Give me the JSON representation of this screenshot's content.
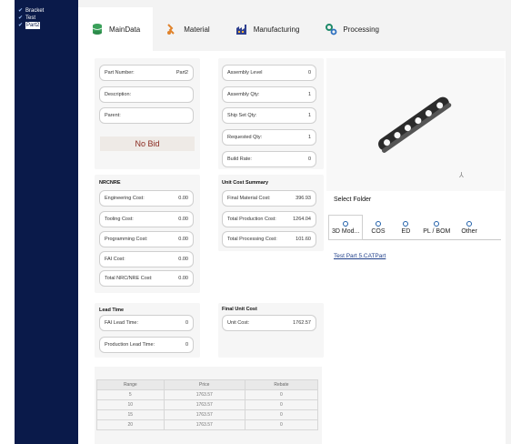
{
  "tree": [
    {
      "label": "Bracket",
      "selected": false
    },
    {
      "label": "Test",
      "selected": false
    },
    {
      "label": "Part2",
      "selected": true
    }
  ],
  "tabs": [
    {
      "label": "MainData",
      "icon": "database-icon",
      "color": "#3aa05a"
    },
    {
      "label": "Material",
      "icon": "material-icon",
      "color": "#e0822a"
    },
    {
      "label": "Manufacturing",
      "icon": "factory-icon",
      "color": "#2e3f8f"
    },
    {
      "label": "Processing",
      "icon": "gears-icon",
      "color": "#1f8a6a"
    }
  ],
  "part": {
    "number_label": "Part Number:",
    "number_value": "Part2",
    "description_label": "Description:",
    "description_value": "",
    "parent_label": "Parent:",
    "parent_value": ""
  },
  "status": "No Bid",
  "assembly": {
    "level_label": "Assembly Level",
    "level_value": "0",
    "qty_label": "Assembly Qty:",
    "qty_value": "1",
    "shipset_label": "Ship Set Qty:",
    "shipset_value": "1",
    "requested_label": "Requested Qty:",
    "requested_value": "1",
    "build_label": "Build Rate:",
    "build_value": "0"
  },
  "nrcnre": {
    "title": "NRCNRE",
    "engineering_label": "Engineering Cost:",
    "engineering_value": "0.00",
    "tooling_label": "Tooling Cost:",
    "tooling_value": "0.00",
    "programming_label": "Programming Cost:",
    "programming_value": "0.00",
    "fai_label": "FAI Cost:",
    "fai_value": "0.00",
    "total_label": "Total NRC/NRE Cost:",
    "total_value": "0.00"
  },
  "unit_summary": {
    "title": "Unit Cost Summary",
    "material_label": "Final Material Cost:",
    "material_value": "396.93",
    "production_label": "Total Production Cost:",
    "production_value": "1264.04",
    "processing_label": "Total Processing Cost:",
    "processing_value": "101.60"
  },
  "lead_time": {
    "title": "Lead Time",
    "fai_label": "FAI Lead Time:",
    "fai_value": "0",
    "production_label": "Production Lead Time:",
    "production_value": "0"
  },
  "final_unit": {
    "title": "Final Unit Cost",
    "unit_label": "Unit Cost:",
    "unit_value": "1762.57"
  },
  "preview": {
    "axis_glyph": "⅄"
  },
  "folders": {
    "title": "Select Folder",
    "items": [
      "3D Mod...",
      "COS",
      "ED",
      "PL / BOM",
      "Other"
    ],
    "active_index": 0,
    "file": "Test Part 5.CATPart"
  },
  "price_table": {
    "headers": [
      "Range",
      "Price",
      "Rebate"
    ],
    "rows": [
      [
        "5",
        "1763.57",
        "0"
      ],
      [
        "10",
        "1763.57",
        "0"
      ],
      [
        "15",
        "1763.57",
        "0"
      ],
      [
        "20",
        "1763.57",
        "0"
      ]
    ]
  },
  "colors": {
    "sidebar": "#0a1a4a",
    "status": "#8a2a20",
    "link": "#1f3f8a"
  }
}
